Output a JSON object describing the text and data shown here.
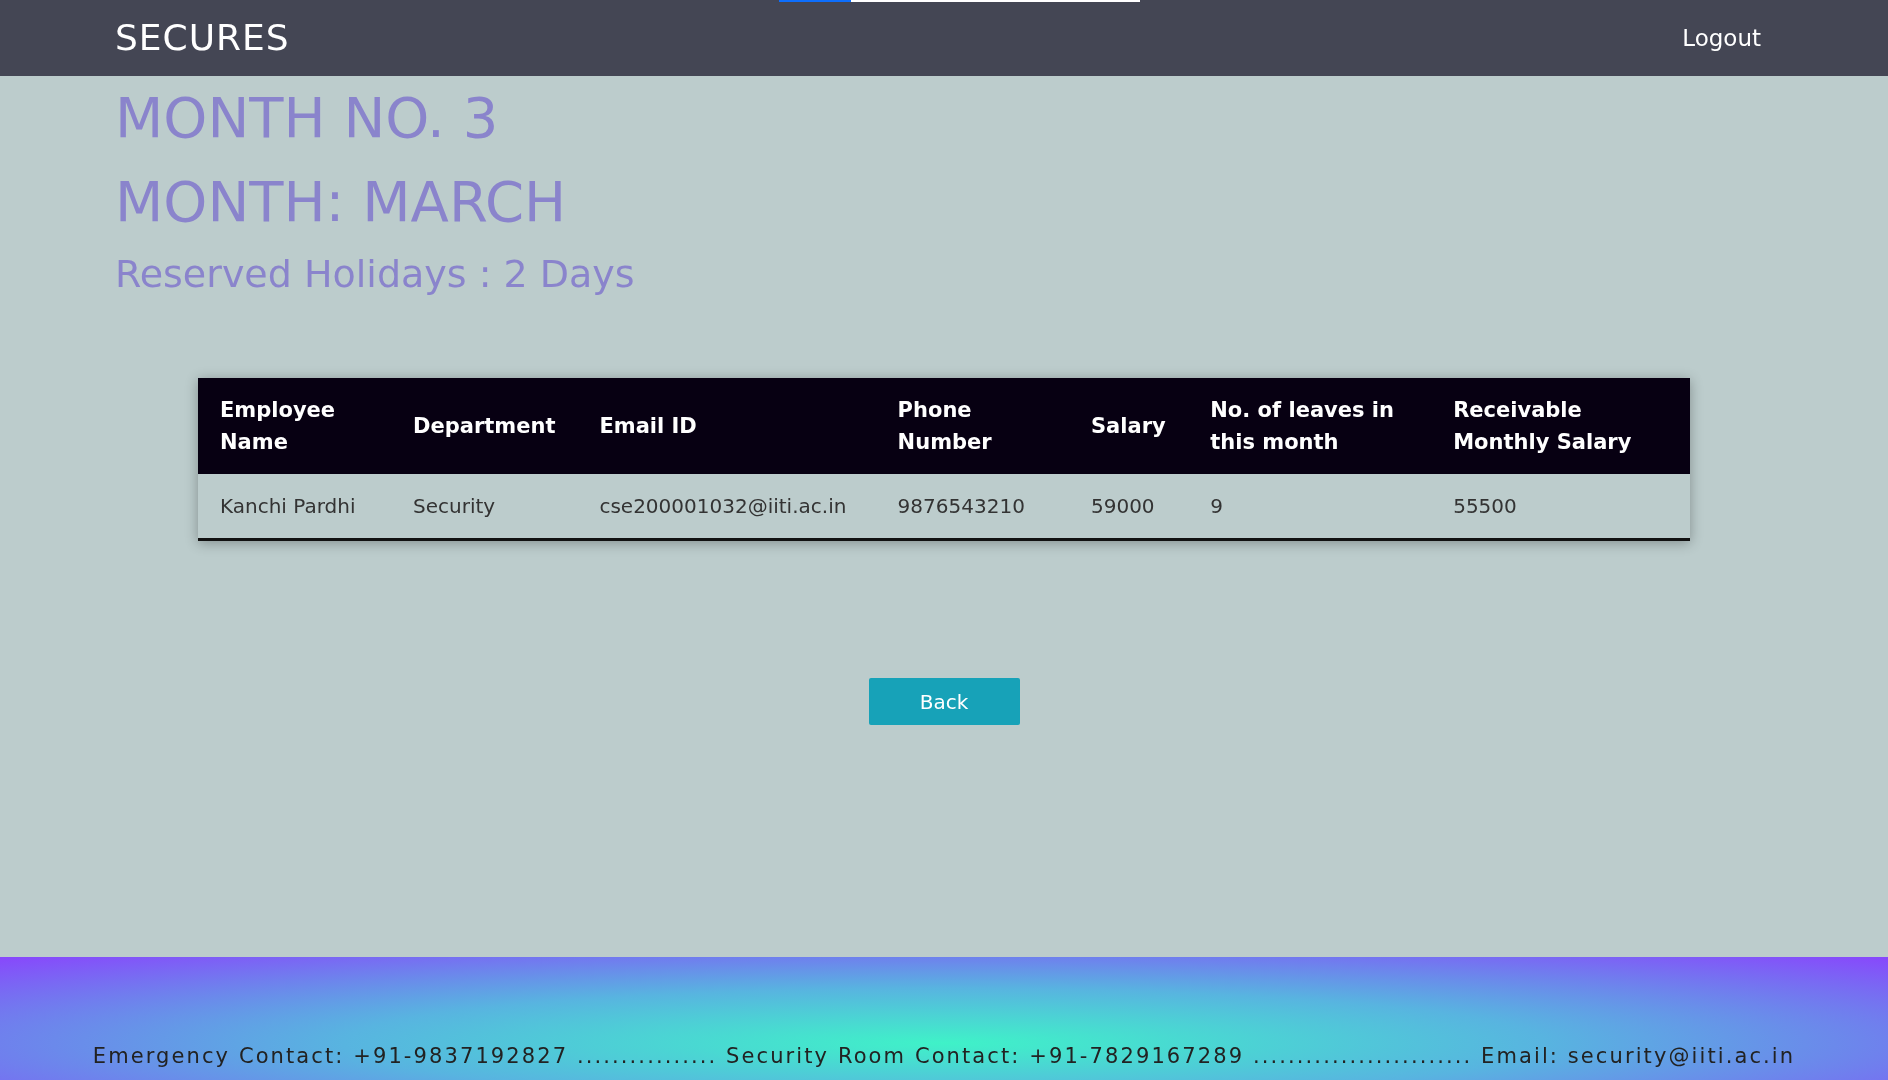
{
  "navbar": {
    "brand": "SECURES",
    "logout": "Logout",
    "loading_bar": {
      "level": 0.2
    }
  },
  "headings": {
    "month_no": "MONTH NO. 3",
    "month": "MONTH: MARCH",
    "holidays": "Reserved Holidays : 2 Days"
  },
  "table": {
    "columns": [
      "Employee Name",
      "Department",
      "Email ID",
      "Phone Number",
      "Salary",
      "No. of leaves in this month",
      "Receivable Monthly Salary"
    ],
    "rows": [
      [
        "Kanchi Pardhi",
        "Security",
        "cse200001032@iiti.ac.in",
        "9876543210",
        "59000",
        "9",
        "55500"
      ]
    ]
  },
  "back_button": "Back",
  "footer": {
    "text": "Emergency Contact: +91-9837192827 ................ Security Room Contact: +91-7829167289 ......................... Email: security@iiti.ac.in"
  }
}
